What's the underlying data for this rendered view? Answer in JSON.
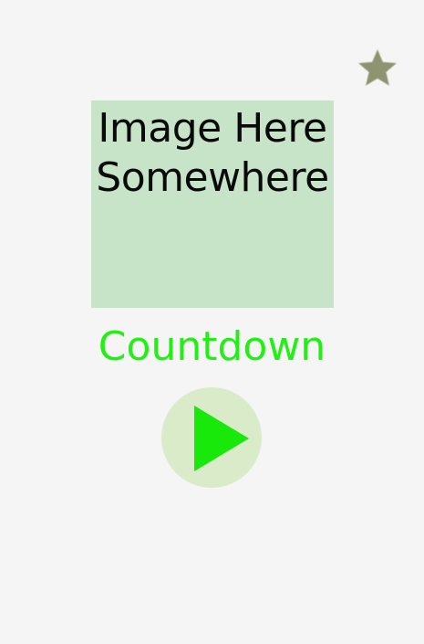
{
  "placeholder": {
    "line1": "Image Here",
    "line2": "Somewhere"
  },
  "countdown": {
    "label": "Countdown"
  },
  "icons": {
    "favorite": "star-icon",
    "play": "play-icon"
  },
  "colors": {
    "background": "#f5f5f5",
    "placeholder_bg": "#c8e4c8",
    "accent_green": "#22f014",
    "play_circle": "#d9ebc8",
    "play_triangle": "#18e80a",
    "star": "#8f9470"
  }
}
